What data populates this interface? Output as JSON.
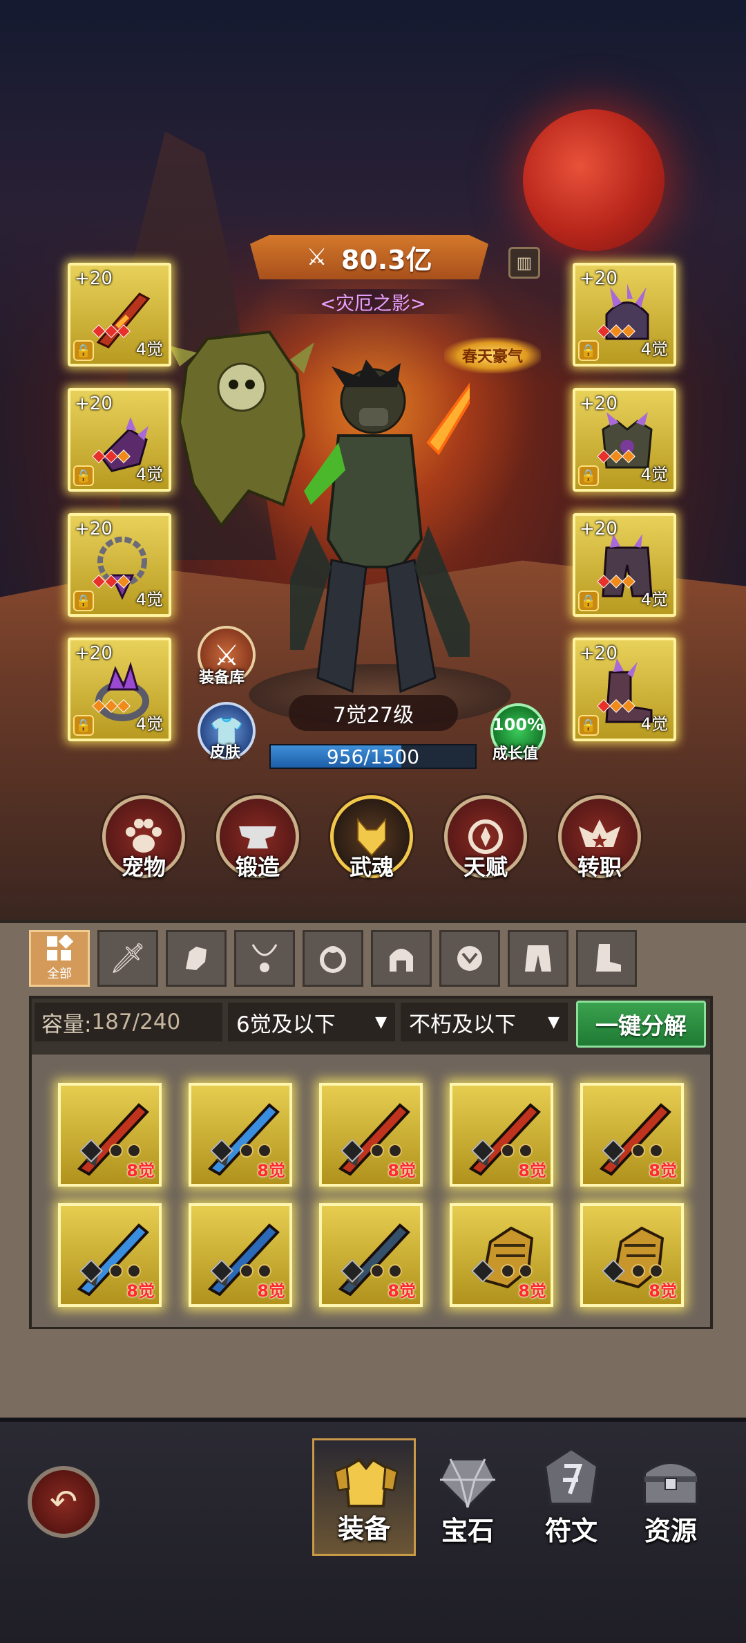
{
  "hero": {
    "power": "80.3亿",
    "title": "<灾厄之影>",
    "badge": "春天豪气",
    "level": "7觉27级",
    "exp_text": "956/1500",
    "exp_current": 956,
    "exp_max": 1500
  },
  "equipment_slots": [
    {
      "plus": "+20",
      "awaken": "4觉",
      "item_icon": "lava-sword",
      "gems": [
        "red",
        "red",
        "red"
      ]
    },
    {
      "plus": "+20",
      "awaken": "4觉",
      "item_icon": "crystal-gauntlet",
      "gems": [
        "red",
        "red",
        "orange"
      ]
    },
    {
      "plus": "+20",
      "awaken": "4觉",
      "item_icon": "chain-necklace",
      "gems": [
        "red",
        "red",
        "orange"
      ]
    },
    {
      "plus": "+20",
      "awaken": "4觉",
      "item_icon": "crystal-ring",
      "gems": [
        "orange",
        "orange",
        "orange"
      ]
    },
    {
      "plus": "+20",
      "awaken": "4觉",
      "item_icon": "spiked-helmet",
      "gems": [
        "red",
        "orange",
        "orange"
      ]
    },
    {
      "plus": "+20",
      "awaken": "4觉",
      "item_icon": "crystal-armor",
      "gems": [
        "red",
        "orange",
        "orange"
      ]
    },
    {
      "plus": "+20",
      "awaken": "4觉",
      "item_icon": "crystal-pants",
      "gems": [
        "red",
        "orange",
        "orange"
      ]
    },
    {
      "plus": "+20",
      "awaken": "4觉",
      "item_icon": "crystal-boots",
      "gems": [
        "red",
        "orange",
        "orange"
      ]
    }
  ],
  "side_buttons": {
    "armory": "装备库",
    "skin": "皮肤",
    "growth_percent": "100%",
    "growth_label": "成长值"
  },
  "skills": [
    {
      "label": "宠物",
      "icon": "paw-icon"
    },
    {
      "label": "锻造",
      "icon": "anvil-icon"
    },
    {
      "label": "武魂",
      "icon": "wolf-icon"
    },
    {
      "label": "天赋",
      "icon": "talent-icon"
    },
    {
      "label": "转职",
      "icon": "class-icon"
    }
  ],
  "tabs": [
    {
      "label": "全部",
      "icon": "grid-icon"
    },
    {
      "icon": "sword-icon"
    },
    {
      "icon": "glove-icon"
    },
    {
      "icon": "necklace-icon"
    },
    {
      "icon": "ring-icon"
    },
    {
      "icon": "helmet-icon"
    },
    {
      "icon": "armor-icon"
    },
    {
      "icon": "pants-icon"
    },
    {
      "icon": "boots-icon"
    }
  ],
  "inventory": {
    "capacity_label": "容量:",
    "capacity_value": "187/240",
    "filter_awaken": "6觉及以下",
    "filter_quality": "不朽及以下",
    "decompose_label": "一键分解",
    "items": [
      {
        "icon": "lava-sword",
        "awaken": "8觉",
        "color": "#c0331d"
      },
      {
        "icon": "ice-sword",
        "awaken": "8觉",
        "color": "#3a8ee0"
      },
      {
        "icon": "lava-sword",
        "awaken": "8觉",
        "color": "#c0331d"
      },
      {
        "icon": "lava-sword",
        "awaken": "8觉",
        "color": "#c0331d"
      },
      {
        "icon": "lava-sword",
        "awaken": "8觉",
        "color": "#c0331d"
      },
      {
        "icon": "ice-sword",
        "awaken": "8觉",
        "color": "#3a8ee0"
      },
      {
        "icon": "blue-blade",
        "awaken": "8觉",
        "color": "#2a6ab8"
      },
      {
        "icon": "dark-blade",
        "awaken": "8觉",
        "color": "#34506a"
      },
      {
        "icon": "gold-gauntlet",
        "awaken": "8觉",
        "color": "#c8962a"
      },
      {
        "icon": "gold-gauntlet",
        "awaken": "8觉",
        "color": "#c8962a"
      }
    ]
  },
  "bottom_nav": [
    {
      "label": "装备",
      "icon": "armor-icon",
      "active": true
    },
    {
      "label": "宝石",
      "icon": "gem-icon",
      "active": false
    },
    {
      "label": "符文",
      "icon": "rune-icon",
      "active": false
    },
    {
      "label": "资源",
      "icon": "chest-icon",
      "active": false
    }
  ]
}
